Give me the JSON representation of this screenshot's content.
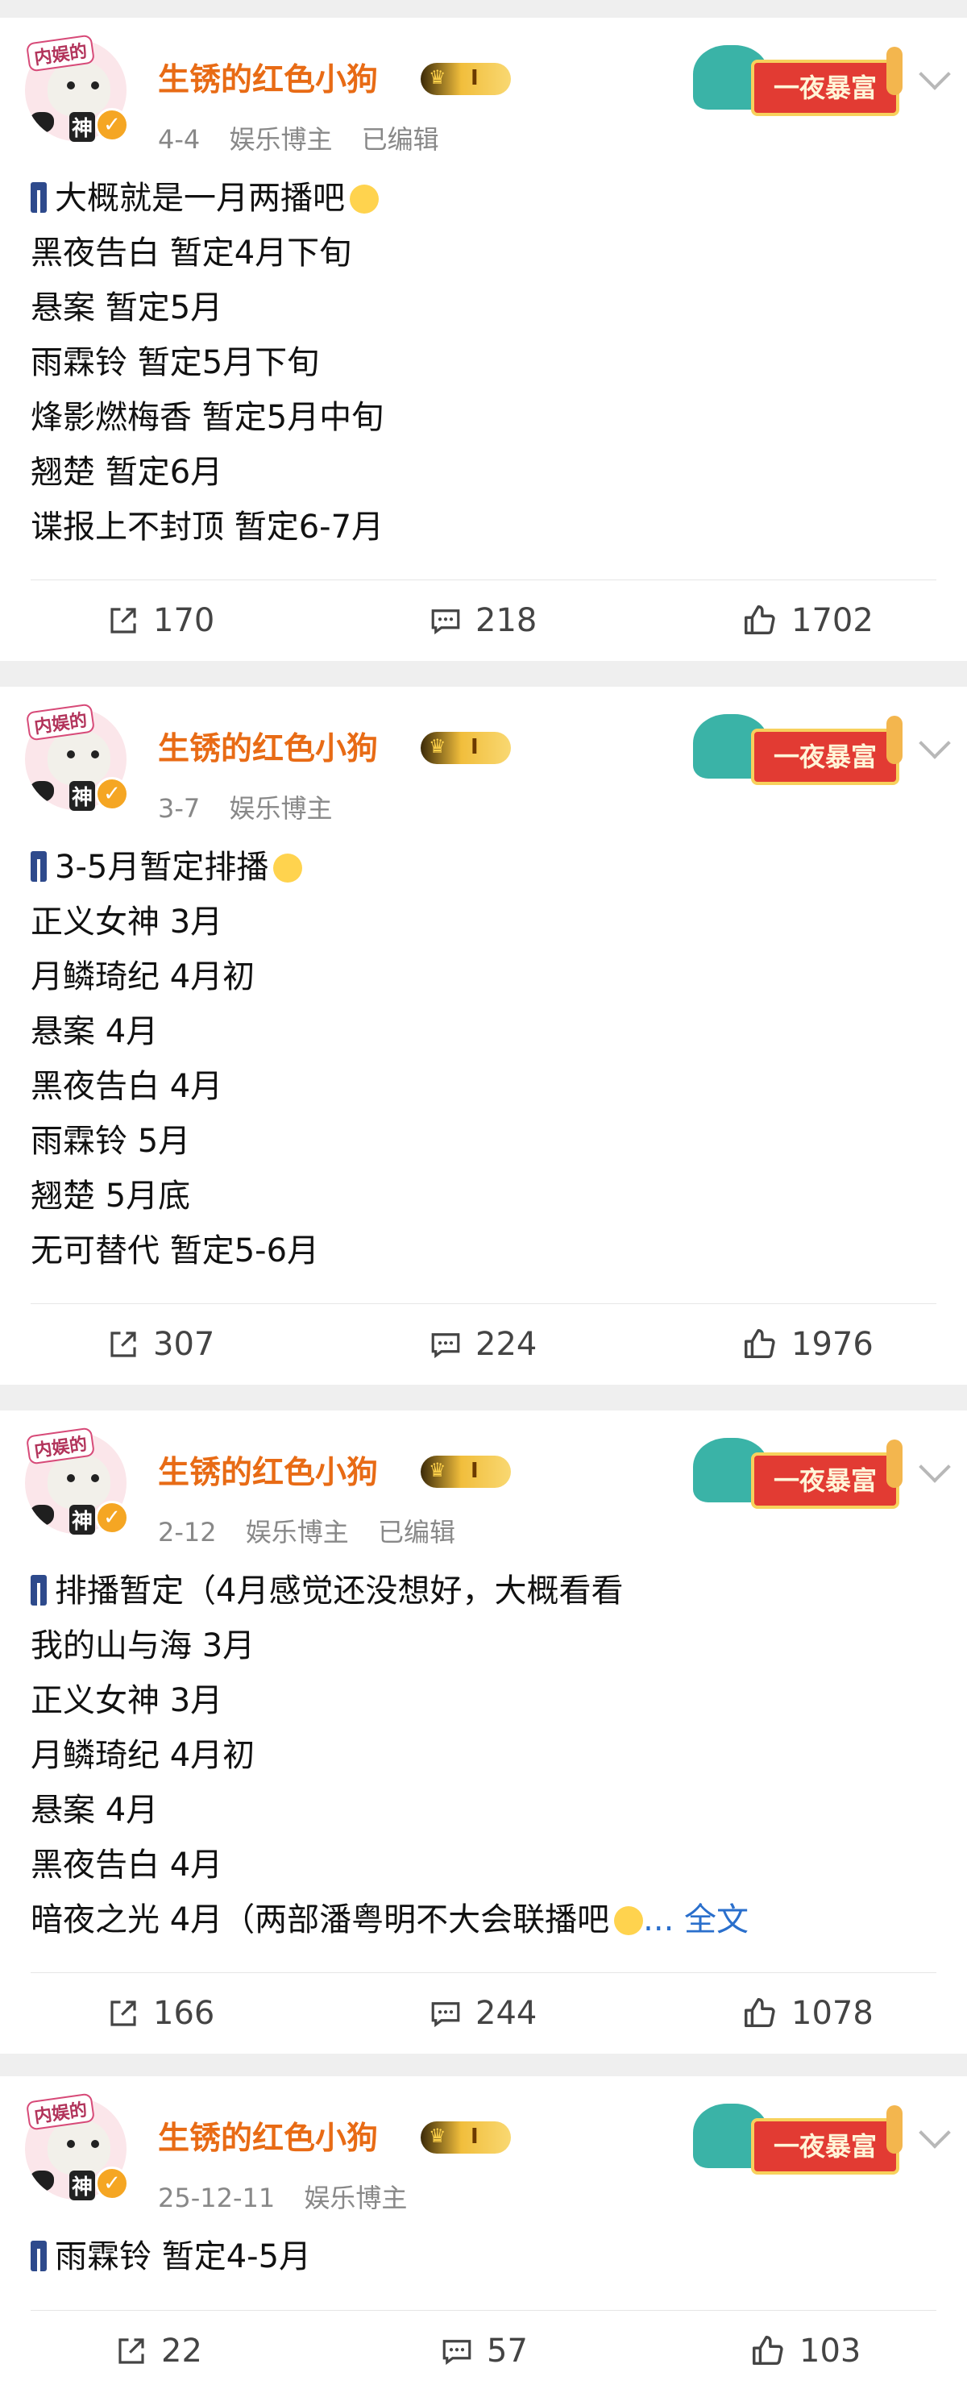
{
  "posts": [
    {
      "user": {
        "name": "生锈的红色小狗",
        "vip_level": "I",
        "avatar_tag": "内娱的",
        "avatar_god": "神"
      },
      "banner": "一夜暴富",
      "meta": {
        "date": "4-4",
        "role": "娱乐博主",
        "edited": "已编辑"
      },
      "lines": [
        "大概就是一月两播吧",
        "黑夜告白 暂定4月下旬",
        "悬案 暂定5月",
        "雨霖铃 暂定5月下旬",
        "烽影燃梅香 暂定5月中旬",
        "翘楚 暂定6月",
        "谍报上不封顶 暂定6-7月"
      ],
      "stats": {
        "share": "170",
        "comment": "218",
        "like": "1702"
      }
    },
    {
      "user": {
        "name": "生锈的红色小狗",
        "vip_level": "I",
        "avatar_tag": "内娱的",
        "avatar_god": "神"
      },
      "banner": "一夜暴富",
      "meta": {
        "date": "3-7",
        "role": "娱乐博主",
        "edited": ""
      },
      "lines": [
        "3-5月暂定排播",
        "正义女神 3月",
        "月鳞琦纪 4月初",
        "悬案 4月",
        "黑夜告白 4月",
        "雨霖铃 5月",
        "翘楚 5月底",
        "无可替代 暂定5-6月"
      ],
      "stats": {
        "share": "307",
        "comment": "224",
        "like": "1976"
      }
    },
    {
      "user": {
        "name": "生锈的红色小狗",
        "vip_level": "I",
        "avatar_tag": "内娱的",
        "avatar_god": "神"
      },
      "banner": "一夜暴富",
      "meta": {
        "date": "2-12",
        "role": "娱乐博主",
        "edited": "已编辑"
      },
      "lines": [
        "排播暂定（4月感觉还没想好，大概看看",
        "我的山与海 3月",
        "正义女神 3月",
        "月鳞琦纪 4月初",
        "悬案 4月",
        "黑夜告白 4月",
        "暗夜之光 4月（两部潘粤明不大会联播吧"
      ],
      "more": "... 全文",
      "stats": {
        "share": "166",
        "comment": "244",
        "like": "1078"
      }
    },
    {
      "user": {
        "name": "生锈的红色小狗",
        "vip_level": "I",
        "avatar_tag": "内娱的",
        "avatar_god": "神"
      },
      "banner": "一夜暴富",
      "meta": {
        "date": "25-12-11",
        "role": "娱乐博主",
        "edited": ""
      },
      "lines": [
        "雨霖铃 暂定4-5月"
      ],
      "stats": {
        "share": "22",
        "comment": "57",
        "like": "103"
      }
    }
  ]
}
